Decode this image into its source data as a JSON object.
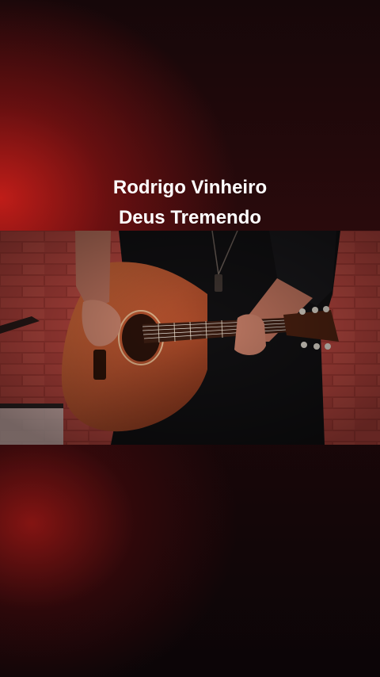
{
  "overlay": {
    "artist": "Rodrigo Vinheiro",
    "song": "Deus Tremendo"
  },
  "colors": {
    "background_glow": "#c81e19",
    "background_dark": "#0d0608",
    "caption_text": "#ffffff",
    "brick": "#b0403a",
    "guitar_body": "#b5522e"
  }
}
